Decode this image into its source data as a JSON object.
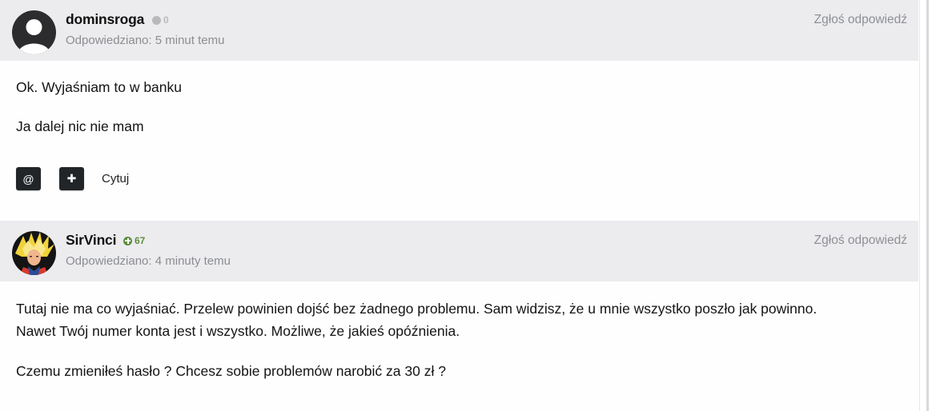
{
  "posts": [
    {
      "username": "dominsroga",
      "reputation": "0",
      "reputation_color": "#b9b9bb",
      "answered_label": "Odpowiedziano:",
      "answered_time": "5 minut temu",
      "report_label": "Zgłoś odpowiedź",
      "paragraphs": [
        "Ok. Wyjaśniam to w banku",
        "Ja dalej nic nie mam"
      ],
      "actions": {
        "mention_icon": "@",
        "plus_icon": "✚",
        "quote_label": "Cytuj"
      }
    },
    {
      "username": "SirVinci",
      "reputation": "67",
      "reputation_color": "#5f8e3e",
      "answered_label": "Odpowiedziano:",
      "answered_time": "4 minuty temu",
      "report_label": "Zgłoś odpowiedź",
      "paragraphs": [
        "Tutaj nie ma co wyjaśniać. Przelew powinien dojść bez żadnego problemu. Sam widzisz, że u mnie wszystko poszło jak powinno.",
        "Nawet Twój numer konta jest i wszystko. Możliwe, że jakieś opóźnienia.",
        "Czemu zmieniłeś hasło ? Chcesz sobie problemów narobić za 30 zł ?"
      ]
    }
  ]
}
